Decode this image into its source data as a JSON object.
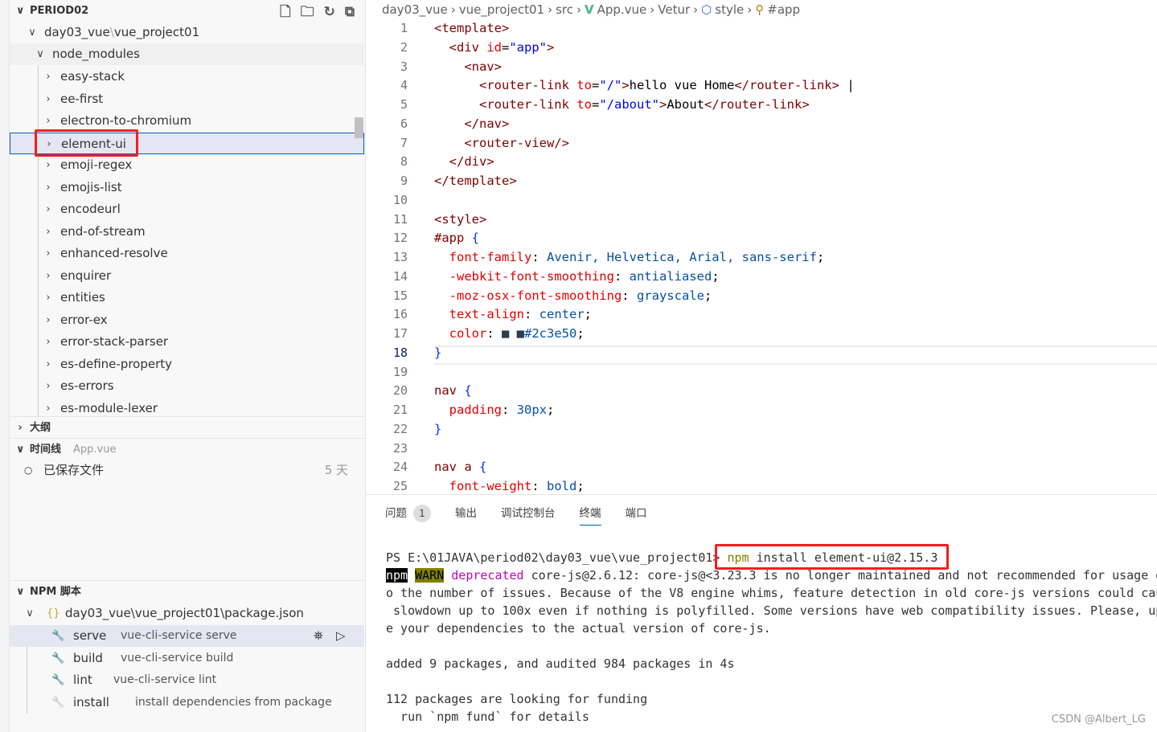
{
  "explorer": {
    "root": "PERIOD02",
    "toolbar_icons": [
      "new-file-icon",
      "new-folder-icon",
      "refresh-icon",
      "collapse-all-icon"
    ],
    "project": "day03_vue",
    "project_sep": "\\",
    "project_sub": "vue_project01",
    "folder": "node_modules",
    "items": [
      "easy-stack",
      "ee-first",
      "electron-to-chromium",
      "element-ui",
      "emoji-regex",
      "emojis-list",
      "encodeurl",
      "end-of-stream",
      "enhanced-resolve",
      "enquirer",
      "entities",
      "error-ex",
      "error-stack-parser",
      "es-define-property",
      "es-errors",
      "es-module-lexer"
    ],
    "selected": "element-ui"
  },
  "outline": {
    "title": "大纲"
  },
  "timeline": {
    "title": "时间线",
    "file": "App.vue",
    "entry": "已保存文件",
    "age": "5 天"
  },
  "npm": {
    "title": "NPM 脚本",
    "package": "day03_vue\\vue_project01\\package.json",
    "scripts": [
      {
        "name": "serve",
        "cmd": "vue-cli-service serve"
      },
      {
        "name": "build",
        "cmd": "vue-cli-service build"
      },
      {
        "name": "lint",
        "cmd": "vue-cli-service lint"
      },
      {
        "name": "install",
        "cmd": "install dependencies from package"
      }
    ]
  },
  "breadcrumb": [
    "day03_vue",
    "vue_project01",
    "src",
    "App.vue",
    "Vetur",
    "style",
    "#app"
  ],
  "editor": {
    "current_line": 18,
    "lines": [
      [
        [
          "<template>",
          "tag"
        ]
      ],
      [
        [
          "  <div ",
          "tag"
        ],
        [
          "id",
          "attr"
        ],
        [
          "=",
          "txt"
        ],
        [
          "\"app\"",
          "str"
        ],
        [
          ">",
          "tag"
        ]
      ],
      [
        [
          "    <nav>",
          "tag"
        ]
      ],
      [
        [
          "      <router-link ",
          "tag"
        ],
        [
          "to",
          "attr"
        ],
        [
          "=",
          "txt"
        ],
        [
          "\"/\"",
          "str"
        ],
        [
          ">",
          "tag"
        ],
        [
          "hello vue Home",
          "txt"
        ],
        [
          "</router-link>",
          "tag"
        ],
        [
          " |",
          "txt"
        ]
      ],
      [
        [
          "      <router-link ",
          "tag"
        ],
        [
          "to",
          "attr"
        ],
        [
          "=",
          "txt"
        ],
        [
          "\"/about\"",
          "str"
        ],
        [
          ">",
          "tag"
        ],
        [
          "About",
          "txt"
        ],
        [
          "</router-link>",
          "tag"
        ]
      ],
      [
        [
          "    </nav>",
          "tag"
        ]
      ],
      [
        [
          "    <router-view/>",
          "tag"
        ]
      ],
      [
        [
          "  </div>",
          "tag"
        ]
      ],
      [
        [
          "</template>",
          "tag"
        ]
      ],
      [],
      [
        [
          "<style>",
          "tag"
        ]
      ],
      [
        [
          "#app ",
          "sel"
        ],
        [
          "{",
          "br"
        ]
      ],
      [
        [
          "  font-family",
          "prop"
        ],
        [
          ": ",
          "txt"
        ],
        [
          "Avenir, Helvetica, Arial, sans-serif",
          "val"
        ],
        [
          ";",
          "txt"
        ]
      ],
      [
        [
          "  -webkit-font-smoothing",
          "prop"
        ],
        [
          ": ",
          "txt"
        ],
        [
          "antialiased",
          "val"
        ],
        [
          ";",
          "txt"
        ]
      ],
      [
        [
          "  -moz-osx-font-smoothing",
          "prop"
        ],
        [
          ": ",
          "txt"
        ],
        [
          "grayscale",
          "val"
        ],
        [
          ";",
          "txt"
        ]
      ],
      [
        [
          "  text-align",
          "prop"
        ],
        [
          ": ",
          "txt"
        ],
        [
          "center",
          "val"
        ],
        [
          ";",
          "txt"
        ]
      ],
      [
        [
          "  color",
          "prop"
        ],
        [
          ": ",
          "txt"
        ],
        [
          "■ ■",
          "sw"
        ],
        [
          "#2c3e50",
          "val"
        ],
        [
          ";",
          "txt"
        ]
      ],
      [
        [
          "}",
          "br"
        ]
      ],
      [],
      [
        [
          "nav ",
          "sel"
        ],
        [
          "{",
          "br"
        ]
      ],
      [
        [
          "  padding",
          "prop"
        ],
        [
          ": ",
          "txt"
        ],
        [
          "30px",
          "val"
        ],
        [
          ";",
          "txt"
        ]
      ],
      [
        [
          "}",
          "br"
        ]
      ],
      [],
      [
        [
          "nav a ",
          "sel"
        ],
        [
          "{",
          "br"
        ]
      ],
      [
        [
          "  font-weight",
          "prop"
        ],
        [
          ": ",
          "txt"
        ],
        [
          "bold",
          "val"
        ],
        [
          ";",
          "txt"
        ]
      ]
    ]
  },
  "panel": {
    "tabs": [
      "问题",
      "输出",
      "调试控制台",
      "终端",
      "端口"
    ],
    "problems_count": "1",
    "active_tab": "终端",
    "terminal": {
      "prompt": "PS E:\\01JAVA\\period02\\day03_vue\\vue_project01>",
      "command_npm": "npm",
      "command_rest": " install element-ui@2.15.3",
      "warn_npm": "npm",
      "warn_label": "WARN",
      "warn_deprecated": "deprecated",
      "warn_text": " core-js@2.6.12: core-js@<3.23.3 is no longer maintained and not recommended for usage d",
      "lines": [
        "o the number of issues. Because of the V8 engine whims, feature detection in old core-js versions could cau",
        " slowdown up to 100x even if nothing is polyfilled. Some versions have web compatibility issues. Please, up",
        "e your dependencies to the actual version of core-js.",
        "",
        "added 9 packages, and audited 984 packages in 4s",
        "",
        "112 packages are looking for funding",
        "  run `npm fund` for details"
      ]
    }
  },
  "watermark": "CSDN @Albert_LG",
  "colors": {
    "highlight": "#f02020",
    "swatch": "#2c3e50",
    "accent": "#005fb8"
  }
}
